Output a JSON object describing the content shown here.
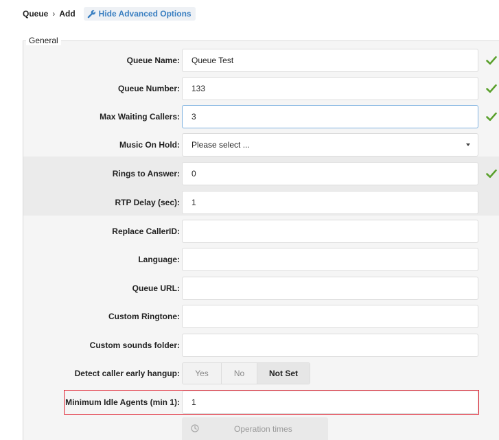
{
  "breadcrumb": {
    "root": "Queue",
    "separator": "›",
    "current": "Add"
  },
  "advanced_toggle": {
    "label": "Hide Advanced Options",
    "icon": "wrench-icon"
  },
  "fieldset": {
    "legend": "General"
  },
  "fields": {
    "queue_name": {
      "label": "Queue Name:",
      "value": "Queue Test",
      "valid": true
    },
    "queue_number": {
      "label": "Queue Number:",
      "value": "133",
      "valid": true
    },
    "max_waiting_callers": {
      "label": "Max Waiting Callers:",
      "value": "3",
      "valid": true
    },
    "music_on_hold": {
      "label": "Music On Hold:",
      "value": "Please select ..."
    },
    "rings_to_answer": {
      "label": "Rings to Answer:",
      "value": "0",
      "valid": true
    },
    "rtp_delay": {
      "label": "RTP Delay (sec):",
      "value": "1"
    },
    "replace_callerid": {
      "label": "Replace CallerID:",
      "value": ""
    },
    "language": {
      "label": "Language:",
      "value": ""
    },
    "queue_url": {
      "label": "Queue URL:",
      "value": ""
    },
    "custom_ringtone": {
      "label": "Custom Ringtone:",
      "value": ""
    },
    "custom_sounds_folder": {
      "label": "Custom sounds folder:",
      "value": ""
    },
    "detect_early_hangup": {
      "label": "Detect caller early hangup:",
      "options": [
        "Yes",
        "No",
        "Not Set"
      ],
      "selected": "Not Set"
    },
    "min_idle_agents": {
      "label": "Minimum Idle Agents (min 1):",
      "value": "1"
    }
  },
  "operation_times": {
    "label": "Operation times",
    "icon": "clock-icon"
  },
  "colors": {
    "link_blue": "#3a7fc1",
    "valid_green": "#5aa02c",
    "highlight_red": "#e0202f",
    "focus_border": "#7fb2e0"
  }
}
